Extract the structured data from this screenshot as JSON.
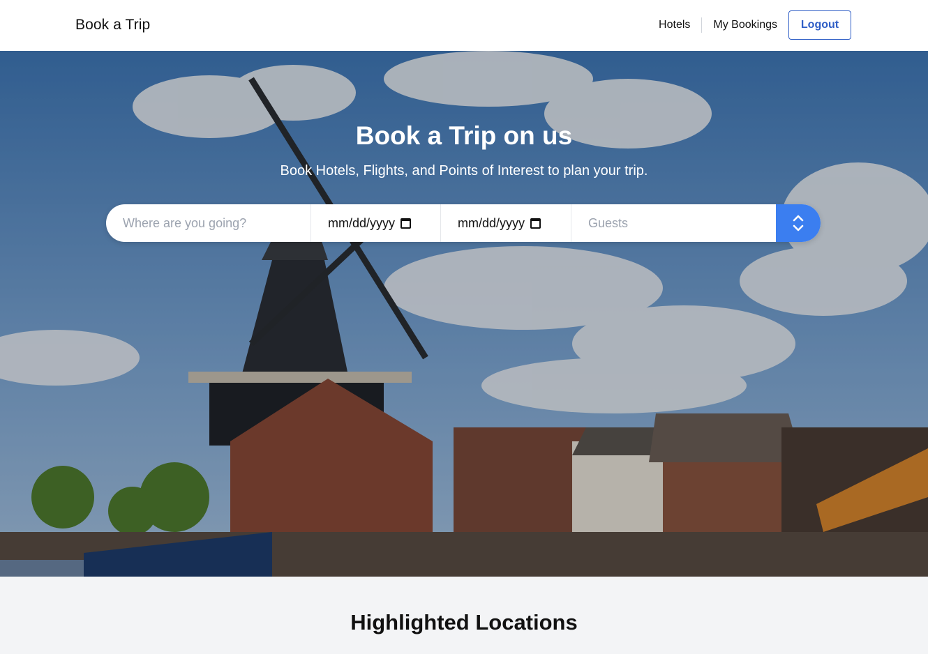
{
  "header": {
    "brand": "Book a Trip",
    "nav": [
      {
        "label": "Hotels"
      },
      {
        "label": "My Bookings"
      }
    ],
    "logout_label": "Logout"
  },
  "hero": {
    "title": "Book a Trip on us",
    "subtitle": "Book Hotels, Flights, and Points of Interest to plan your trip.",
    "background_image": "windmill-canal-town-photo"
  },
  "search": {
    "destination_placeholder": "Where are you going?",
    "checkin_value": "mm/dd/yyyy",
    "checkout_value": "mm/dd/yyyy",
    "guests_placeholder": "Guests",
    "button_icon": "chevron-up-down-icon",
    "button_color": "#3b7ef0"
  },
  "highlighted": {
    "title": "Highlighted Locations"
  },
  "colors": {
    "accent": "#2f5ec6",
    "page_bg": "#f3f4f6"
  }
}
